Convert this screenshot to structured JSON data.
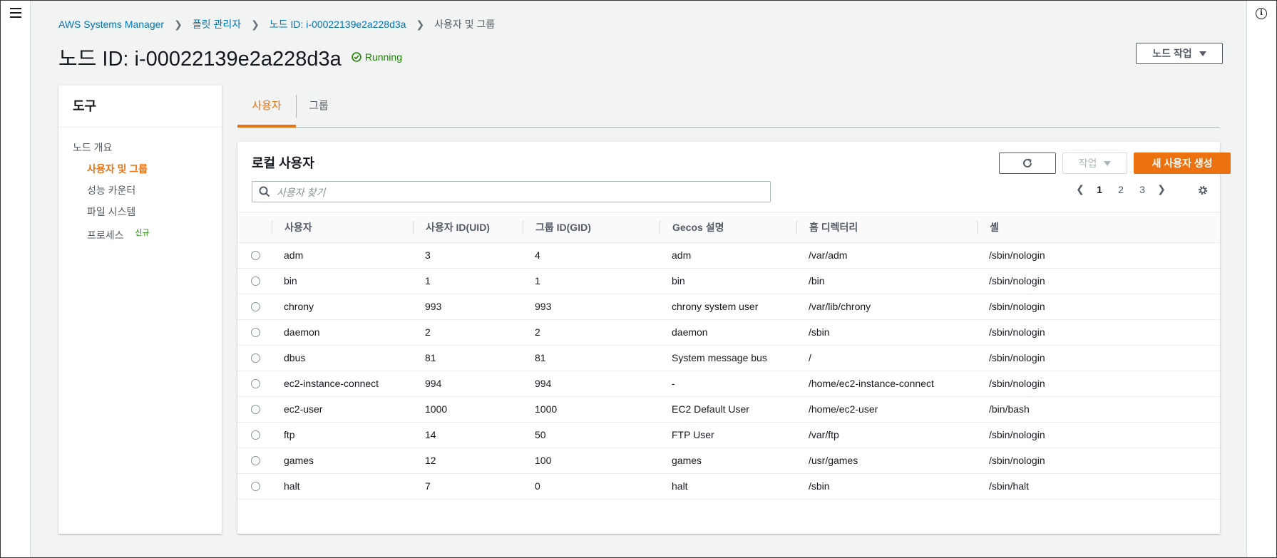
{
  "breadcrumb": {
    "items": [
      "AWS Systems Manager",
      "플릿 관리자",
      "노드 ID: i-00022139e2a228d3a"
    ],
    "current": "사용자 및 그룹"
  },
  "page": {
    "title": "노드 ID: i-00022139e2a228d3a",
    "status": "Running",
    "node_action_label": "노드 작업"
  },
  "tools": {
    "title": "도구",
    "overview": "노드 개요",
    "items": [
      {
        "label": "사용자 및 그룹",
        "active": true
      },
      {
        "label": "성능 카운터",
        "active": false
      },
      {
        "label": "파일 시스템",
        "active": false
      },
      {
        "label": "프로세스",
        "active": false,
        "badge": "신규"
      }
    ]
  },
  "tabs": [
    "사용자",
    "그룹"
  ],
  "table": {
    "title": "로컬 사용자",
    "search_placeholder": "사용자 찾기",
    "action_label": "작업",
    "create_label": "새 사용자 생성",
    "pages": [
      "1",
      "2",
      "3"
    ],
    "columns": [
      "사용자",
      "사용자 ID(UID)",
      "그룹 ID(GID)",
      "Gecos 설명",
      "홈 디렉터리",
      "셸"
    ],
    "rows": [
      [
        "adm",
        "3",
        "4",
        "adm",
        "/var/adm",
        "/sbin/nologin"
      ],
      [
        "bin",
        "1",
        "1",
        "bin",
        "/bin",
        "/sbin/nologin"
      ],
      [
        "chrony",
        "993",
        "993",
        "chrony system user",
        "/var/lib/chrony",
        "/sbin/nologin"
      ],
      [
        "daemon",
        "2",
        "2",
        "daemon",
        "/sbin",
        "/sbin/nologin"
      ],
      [
        "dbus",
        "81",
        "81",
        "System message bus",
        "/",
        "/sbin/nologin"
      ],
      [
        "ec2-instance-connect",
        "994",
        "994",
        "-",
        "/home/ec2-instance-connect",
        "/sbin/nologin"
      ],
      [
        "ec2-user",
        "1000",
        "1000",
        "EC2 Default User",
        "/home/ec2-user",
        "/bin/bash"
      ],
      [
        "ftp",
        "14",
        "50",
        "FTP User",
        "/var/ftp",
        "/sbin/nologin"
      ],
      [
        "games",
        "12",
        "100",
        "games",
        "/usr/games",
        "/sbin/nologin"
      ],
      [
        "halt",
        "7",
        "0",
        "halt",
        "/sbin",
        "/sbin/halt"
      ]
    ]
  },
  "colors": {
    "accent": "#ec7211",
    "link": "#0073bb",
    "status_ok": "#1d8102"
  }
}
